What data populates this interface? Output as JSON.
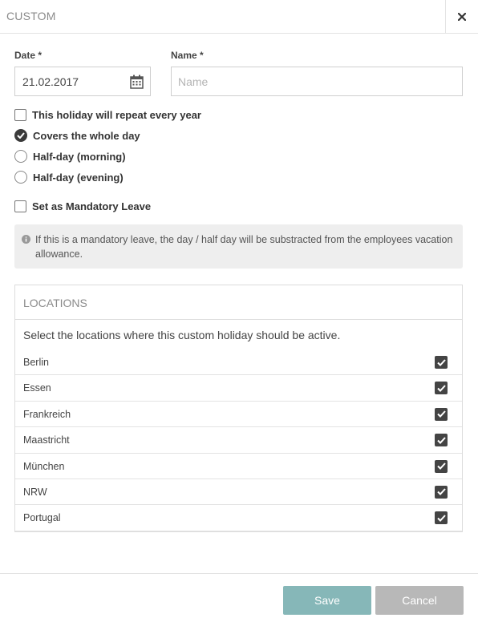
{
  "dialog": {
    "title": "CUSTOM",
    "close_icon": "close-icon"
  },
  "form": {
    "date_label": "Date *",
    "date_value": "21.02.2017",
    "name_label": "Name *",
    "name_placeholder": "Name",
    "name_value": ""
  },
  "options": {
    "repeat_yearly": {
      "label": "This holiday will repeat every year",
      "checked": false
    },
    "coverage_selected": "whole_day",
    "whole_day": {
      "label": "Covers the whole day"
    },
    "half_day_morning": {
      "label": "Half-day (morning)"
    },
    "half_day_evening": {
      "label": "Half-day (evening)"
    },
    "mandatory_leave": {
      "label": "Set as Mandatory Leave",
      "checked": false
    }
  },
  "info": {
    "text": "If this is a mandatory leave, the day / half day will be substracted from the employees vacation allowance."
  },
  "locations": {
    "title": "LOCATIONS",
    "description": "Select the locations where this custom holiday should be active.",
    "items": [
      {
        "name": "Berlin",
        "checked": true
      },
      {
        "name": "Essen",
        "checked": true
      },
      {
        "name": "Frankreich",
        "checked": true
      },
      {
        "name": "Maastricht",
        "checked": true
      },
      {
        "name": "München",
        "checked": true
      },
      {
        "name": "NRW",
        "checked": true
      },
      {
        "name": "Portugal",
        "checked": true
      }
    ]
  },
  "footer": {
    "save_label": "Save",
    "cancel_label": "Cancel"
  },
  "colors": {
    "save_button": "#86b7b8",
    "cancel_button": "#b8b8b8",
    "checkbox_checked": "#444444",
    "info_background": "#eeeeee"
  }
}
